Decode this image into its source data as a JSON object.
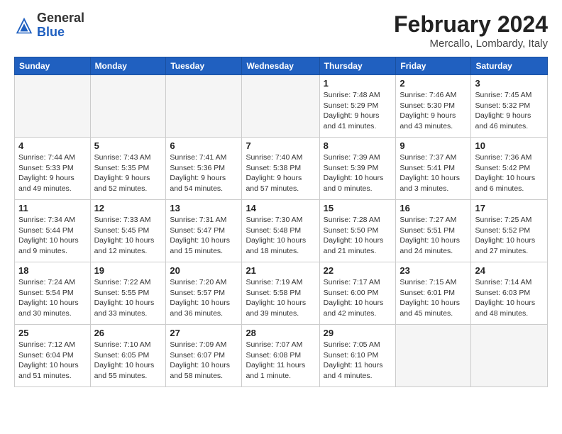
{
  "logo": {
    "general": "General",
    "blue": "Blue"
  },
  "header": {
    "month_year": "February 2024",
    "location": "Mercallo, Lombardy, Italy"
  },
  "weekdays": [
    "Sunday",
    "Monday",
    "Tuesday",
    "Wednesday",
    "Thursday",
    "Friday",
    "Saturday"
  ],
  "weeks": [
    [
      {
        "day": "",
        "info": ""
      },
      {
        "day": "",
        "info": ""
      },
      {
        "day": "",
        "info": ""
      },
      {
        "day": "",
        "info": ""
      },
      {
        "day": "1",
        "info": "Sunrise: 7:48 AM\nSunset: 5:29 PM\nDaylight: 9 hours\nand 41 minutes."
      },
      {
        "day": "2",
        "info": "Sunrise: 7:46 AM\nSunset: 5:30 PM\nDaylight: 9 hours\nand 43 minutes."
      },
      {
        "day": "3",
        "info": "Sunrise: 7:45 AM\nSunset: 5:32 PM\nDaylight: 9 hours\nand 46 minutes."
      }
    ],
    [
      {
        "day": "4",
        "info": "Sunrise: 7:44 AM\nSunset: 5:33 PM\nDaylight: 9 hours\nand 49 minutes."
      },
      {
        "day": "5",
        "info": "Sunrise: 7:43 AM\nSunset: 5:35 PM\nDaylight: 9 hours\nand 52 minutes."
      },
      {
        "day": "6",
        "info": "Sunrise: 7:41 AM\nSunset: 5:36 PM\nDaylight: 9 hours\nand 54 minutes."
      },
      {
        "day": "7",
        "info": "Sunrise: 7:40 AM\nSunset: 5:38 PM\nDaylight: 9 hours\nand 57 minutes."
      },
      {
        "day": "8",
        "info": "Sunrise: 7:39 AM\nSunset: 5:39 PM\nDaylight: 10 hours\nand 0 minutes."
      },
      {
        "day": "9",
        "info": "Sunrise: 7:37 AM\nSunset: 5:41 PM\nDaylight: 10 hours\nand 3 minutes."
      },
      {
        "day": "10",
        "info": "Sunrise: 7:36 AM\nSunset: 5:42 PM\nDaylight: 10 hours\nand 6 minutes."
      }
    ],
    [
      {
        "day": "11",
        "info": "Sunrise: 7:34 AM\nSunset: 5:44 PM\nDaylight: 10 hours\nand 9 minutes."
      },
      {
        "day": "12",
        "info": "Sunrise: 7:33 AM\nSunset: 5:45 PM\nDaylight: 10 hours\nand 12 minutes."
      },
      {
        "day": "13",
        "info": "Sunrise: 7:31 AM\nSunset: 5:47 PM\nDaylight: 10 hours\nand 15 minutes."
      },
      {
        "day": "14",
        "info": "Sunrise: 7:30 AM\nSunset: 5:48 PM\nDaylight: 10 hours\nand 18 minutes."
      },
      {
        "day": "15",
        "info": "Sunrise: 7:28 AM\nSunset: 5:50 PM\nDaylight: 10 hours\nand 21 minutes."
      },
      {
        "day": "16",
        "info": "Sunrise: 7:27 AM\nSunset: 5:51 PM\nDaylight: 10 hours\nand 24 minutes."
      },
      {
        "day": "17",
        "info": "Sunrise: 7:25 AM\nSunset: 5:52 PM\nDaylight: 10 hours\nand 27 minutes."
      }
    ],
    [
      {
        "day": "18",
        "info": "Sunrise: 7:24 AM\nSunset: 5:54 PM\nDaylight: 10 hours\nand 30 minutes."
      },
      {
        "day": "19",
        "info": "Sunrise: 7:22 AM\nSunset: 5:55 PM\nDaylight: 10 hours\nand 33 minutes."
      },
      {
        "day": "20",
        "info": "Sunrise: 7:20 AM\nSunset: 5:57 PM\nDaylight: 10 hours\nand 36 minutes."
      },
      {
        "day": "21",
        "info": "Sunrise: 7:19 AM\nSunset: 5:58 PM\nDaylight: 10 hours\nand 39 minutes."
      },
      {
        "day": "22",
        "info": "Sunrise: 7:17 AM\nSunset: 6:00 PM\nDaylight: 10 hours\nand 42 minutes."
      },
      {
        "day": "23",
        "info": "Sunrise: 7:15 AM\nSunset: 6:01 PM\nDaylight: 10 hours\nand 45 minutes."
      },
      {
        "day": "24",
        "info": "Sunrise: 7:14 AM\nSunset: 6:03 PM\nDaylight: 10 hours\nand 48 minutes."
      }
    ],
    [
      {
        "day": "25",
        "info": "Sunrise: 7:12 AM\nSunset: 6:04 PM\nDaylight: 10 hours\nand 51 minutes."
      },
      {
        "day": "26",
        "info": "Sunrise: 7:10 AM\nSunset: 6:05 PM\nDaylight: 10 hours\nand 55 minutes."
      },
      {
        "day": "27",
        "info": "Sunrise: 7:09 AM\nSunset: 6:07 PM\nDaylight: 10 hours\nand 58 minutes."
      },
      {
        "day": "28",
        "info": "Sunrise: 7:07 AM\nSunset: 6:08 PM\nDaylight: 11 hours\nand 1 minute."
      },
      {
        "day": "29",
        "info": "Sunrise: 7:05 AM\nSunset: 6:10 PM\nDaylight: 11 hours\nand 4 minutes."
      },
      {
        "day": "",
        "info": ""
      },
      {
        "day": "",
        "info": ""
      }
    ]
  ]
}
